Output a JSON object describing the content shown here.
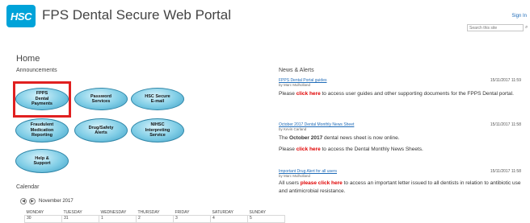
{
  "header": {
    "logo_text": "HSC",
    "site_title": "FPS Dental Secure Web Portal",
    "sign_in": "Sign In",
    "search_placeholder": "Search this site"
  },
  "page_title": "Home",
  "announcements": {
    "heading": "Announcements",
    "buttons": [
      {
        "label": "FPPS Dental Payments"
      },
      {
        "label": "Password Services"
      },
      {
        "label": "HSC Secure E-mail"
      },
      {
        "label": "Fraudulent Medication Reporting"
      },
      {
        "label": "Drug/Safety Alerts"
      },
      {
        "label": "NIHSC Interpreting Service"
      },
      {
        "label": "Help & Support"
      }
    ],
    "highlight_color": "#e02020"
  },
  "calendar": {
    "heading": "Calendar",
    "month": "November 2017",
    "days": [
      "MONDAY",
      "TUESDAY",
      "WEDNESDAY",
      "THURSDAY",
      "FRIDAY",
      "SATURDAY",
      "SUNDAY"
    ],
    "first_row": [
      "30",
      "31",
      "1",
      "2",
      "3",
      "4",
      "5"
    ]
  },
  "news": {
    "heading": "News & Alerts",
    "items": [
      {
        "title": "FPPS Dental Portal guides",
        "author": "by Marc Mulholland",
        "date": "15/11/2017 11:59",
        "p1_pre": "Please ",
        "p1_link": "click here",
        "p1_post": " to access user guides and other supporting documents for the FPPS Dental portal."
      },
      {
        "title": "October 2017 Dental Monthly News Sheet",
        "author": "by Kevin Carland",
        "date": "15/11/2017 11:58",
        "p1_pre": "The ",
        "p1_bold": "October 2017",
        "p1_post": " dental news sheet is now online.",
        "p2_pre": "Please ",
        "p2_link": "click here",
        "p2_post": " to access the Dental Monthly News Sheets."
      },
      {
        "title": "Important Drug Alert for all users",
        "author": "by Marc Mulholland",
        "date": "15/11/2017 11:58",
        "p1_pre": "All users ",
        "p1_link": "please click here",
        "p1_post": " to access an important letter issued to all dentists in relation to antibiotic use and antimicrobial resistance."
      }
    ]
  }
}
